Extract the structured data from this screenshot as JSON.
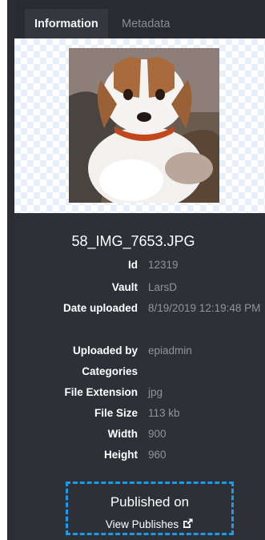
{
  "tabs": [
    {
      "label": "Information",
      "active": true
    },
    {
      "label": "Metadata",
      "active": false
    }
  ],
  "preview": {
    "image_icon": "puppy-photo"
  },
  "file": {
    "name": "58_IMG_7653.JPG"
  },
  "properties": [
    {
      "label": "Id",
      "value": "12319"
    },
    {
      "label": "Vault",
      "value": "LarsD"
    },
    {
      "label": "Date uploaded",
      "value": "8/19/2019 12:19:48 PM"
    },
    {
      "label": "Uploaded by",
      "value": "epiadmin"
    },
    {
      "label": "Categories",
      "value": ""
    },
    {
      "label": "File Extension",
      "value": "jpg"
    },
    {
      "label": "File Size",
      "value": "113 kb"
    },
    {
      "label": "Width",
      "value": "900"
    },
    {
      "label": "Height",
      "value": "960"
    }
  ],
  "publish": {
    "title": "Published on",
    "link_label": "View Publishes",
    "link_icon": "external-link-icon"
  },
  "colors": {
    "panel_bg": "#2d3036",
    "accent_dashed": "#1d9bea",
    "muted_value": "#90949b"
  }
}
